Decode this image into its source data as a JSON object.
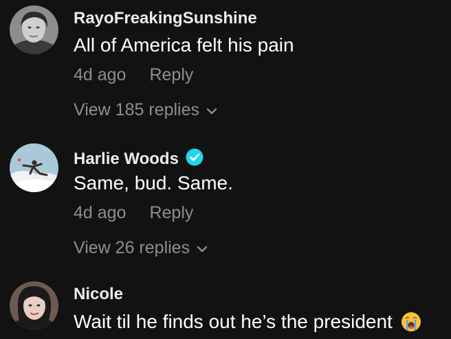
{
  "comments": [
    {
      "username": "RayoFreakingSunshine",
      "text": "All of America felt his pain",
      "time": "4d ago",
      "reply_label": "Reply",
      "view_replies": "View 185 replies",
      "verified": false,
      "avatar_icon": "user-photo"
    },
    {
      "username": "Harlie Woods",
      "text": "Same, bud. Same.",
      "time": "4d ago",
      "reply_label": "Reply",
      "view_replies": "View 26 replies",
      "verified": true,
      "avatar_icon": "user-photo"
    },
    {
      "username": "Nicole",
      "text": "Wait til he finds out he’s the president",
      "verified": false,
      "avatar_icon": "user-photo",
      "emoji": "crying-face"
    }
  ],
  "colors": {
    "background": "#121212",
    "muted_text": "#8e8e8e",
    "verified_badge": "#20d5ec"
  }
}
